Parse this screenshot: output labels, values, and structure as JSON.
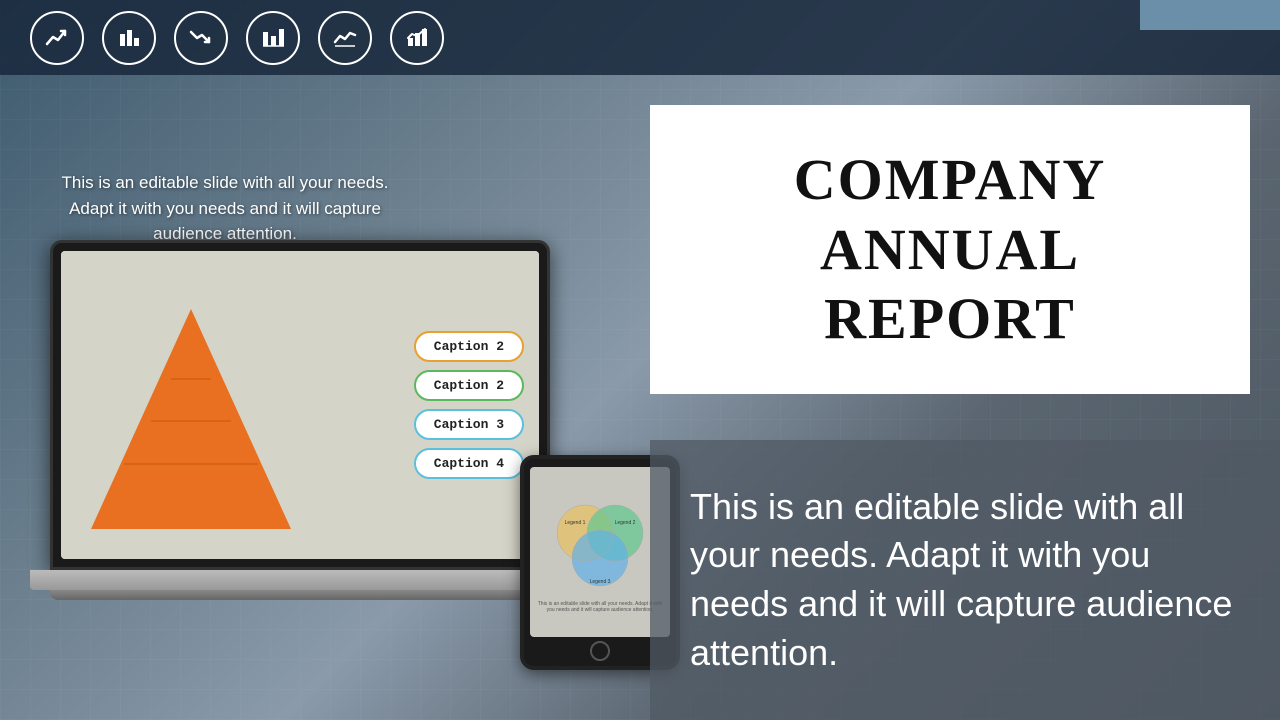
{
  "topBar": {
    "icons": [
      {
        "name": "line-chart-up-icon",
        "symbol": "📈"
      },
      {
        "name": "bar-chart-icon",
        "symbol": "📊"
      },
      {
        "name": "line-chart-down-icon",
        "symbol": "📉"
      },
      {
        "name": "bar-chart-2-icon",
        "symbol": "📊"
      },
      {
        "name": "trend-icon",
        "symbol": "📈"
      },
      {
        "name": "bar-chart-3-icon",
        "symbol": "📊"
      }
    ]
  },
  "leftSection": {
    "introText": "This is an editable slide with all your needs. Adapt it with you needs and it will capture audience attention."
  },
  "laptop": {
    "captions": [
      {
        "label": "Caption 2",
        "colorClass": "c1"
      },
      {
        "label": "Caption 2",
        "colorClass": "c2"
      },
      {
        "label": "Caption 3",
        "colorClass": "c3"
      },
      {
        "label": "Caption 4",
        "colorClass": "c4"
      }
    ]
  },
  "tablet": {
    "vennText": "This is an editable slide with all your needs. Adapt it with you needs and it will capture audience attention."
  },
  "titleBox": {
    "line1": "COMPANY",
    "line2": "ANNUAL REPORT"
  },
  "bottomRight": {
    "text": "This is an editable slide with all your needs. Adapt it with you needs and it will capture audience attention."
  }
}
